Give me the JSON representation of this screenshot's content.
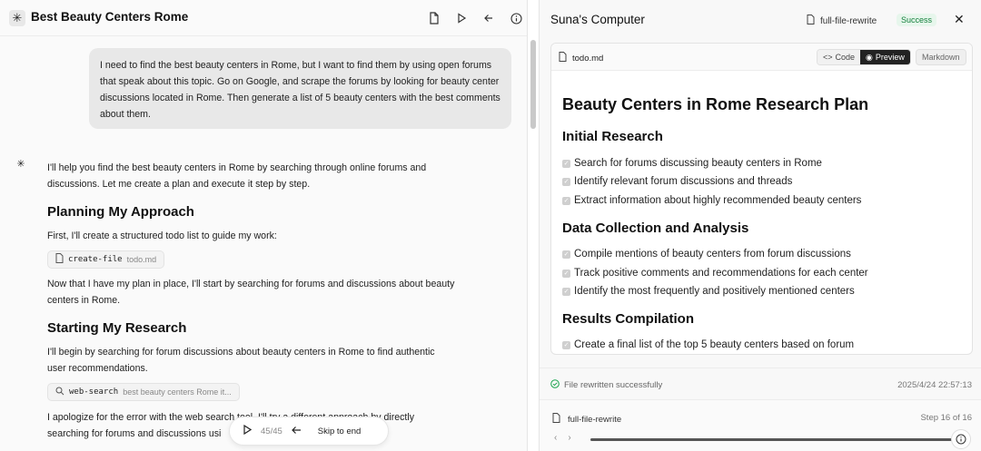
{
  "left": {
    "title": "Best Beauty Centers Rome",
    "user_message": "I need to find the best beauty centers in Rome, but I want to find them by using open forums that speak about this topic. Go on Google, and scrape the forums by looking for beauty center discussions located in Rome. Then generate a list of 5 beauty centers with the best comments about them.",
    "intro": "I'll help you find the best beauty centers in Rome by searching through online forums and discussions. Let me create a plan and execute it step by step.",
    "h_planning": "Planning My Approach",
    "p_planning": "First, I'll create a structured todo list to guide my work:",
    "tool1_name": "create-file",
    "tool1_arg": "todo.md",
    "p_after_plan": "Now that I have my plan in place, I'll start by searching for forums and discussions about beauty centers in Rome.",
    "h_research": "Starting My Research",
    "p_research": "I'll begin by searching for forum discussions about beauty centers in Rome to find authentic user recommendations.",
    "tool2_name": "web-search",
    "tool2_arg": "best beauty centers Rome it...",
    "p_apology_a": "I apologize for the error with the web search tool. I'll try a different approach by directly",
    "p_apology_b": "searching for forums and discussions usi",
    "player_count": "45/45",
    "player_skip": "Skip to end"
  },
  "right": {
    "title": "Suna's Computer",
    "tool_name": "full-file-rewrite",
    "badge": "Success",
    "file_name": "todo.md",
    "tab_code": "Code",
    "tab_preview": "Preview",
    "tab_markdown": "Markdown",
    "doc_title": "Beauty Centers in Rome Research Plan",
    "sections": [
      {
        "heading": "Initial Research",
        "items": [
          "Search for forums discussing beauty centers in Rome",
          "Identify relevant forum discussions and threads",
          "Extract information about highly recommended beauty centers"
        ]
      },
      {
        "heading": "Data Collection and Analysis",
        "items": [
          "Compile mentions of beauty centers from forum discussions",
          "Track positive comments and recommendations for each center",
          "Identify the most frequently and positively mentioned centers"
        ]
      },
      {
        "heading": "Results Compilation",
        "items": [
          "Create a final list of the top 5 beauty centers based on forum"
        ]
      }
    ],
    "status_msg": "File rewritten successfully",
    "status_time": "2025/4/24 22:57:13",
    "step_tool": "full-file-rewrite",
    "step_count": "Step 16 of 16",
    "progress_fraction": 1.0
  }
}
